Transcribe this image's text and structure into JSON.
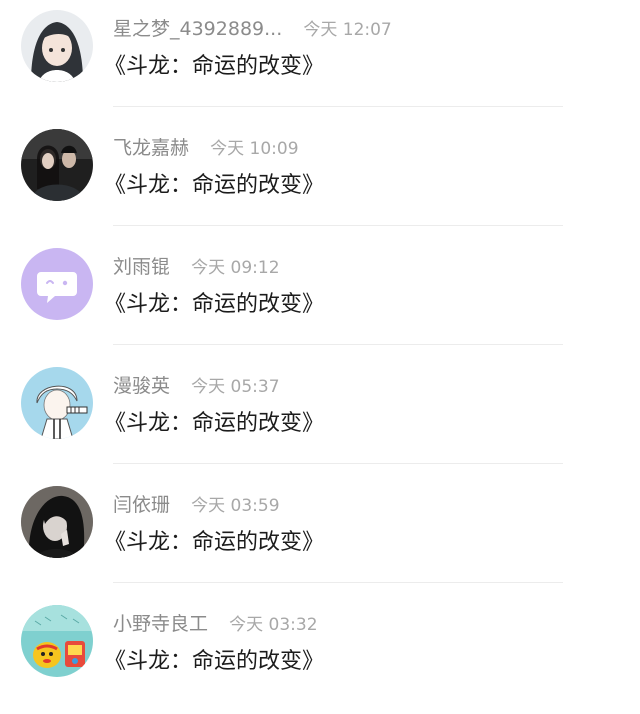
{
  "messages": [
    {
      "name": "星之梦_4392889...",
      "time": "今天 12:07",
      "text": "《斗龙：命运的改变》",
      "avatar_icon": "anime-girl-avatar-icon"
    },
    {
      "name": "飞龙嘉赫",
      "time": "今天 10:09",
      "text": "《斗龙：命运的改变》",
      "avatar_icon": "photo-couple-avatar-icon"
    },
    {
      "name": "刘雨锟",
      "time": "今天 09:12",
      "text": "《斗龙：命运的改变》",
      "avatar_icon": "default-chat-avatar-icon"
    },
    {
      "name": "漫骏英",
      "time": "今天 05:37",
      "text": "《斗龙：命运的改变》",
      "avatar_icon": "anime-boy-avatar-icon"
    },
    {
      "name": "闫依珊",
      "time": "今天 03:59",
      "text": "《斗龙：命运的改变》",
      "avatar_icon": "dark-anime-avatar-icon"
    },
    {
      "name": "小野寺良工",
      "time": "今天 03:32",
      "text": "《斗龙：命运的改变》",
      "avatar_icon": "colorful-cartoon-avatar-icon"
    }
  ],
  "colors": {
    "name": "#8b8b8b",
    "time": "#a8a8a8",
    "message": "#1c1c1c",
    "divider": "#ececec",
    "default_avatar": "#c9b6f2"
  }
}
